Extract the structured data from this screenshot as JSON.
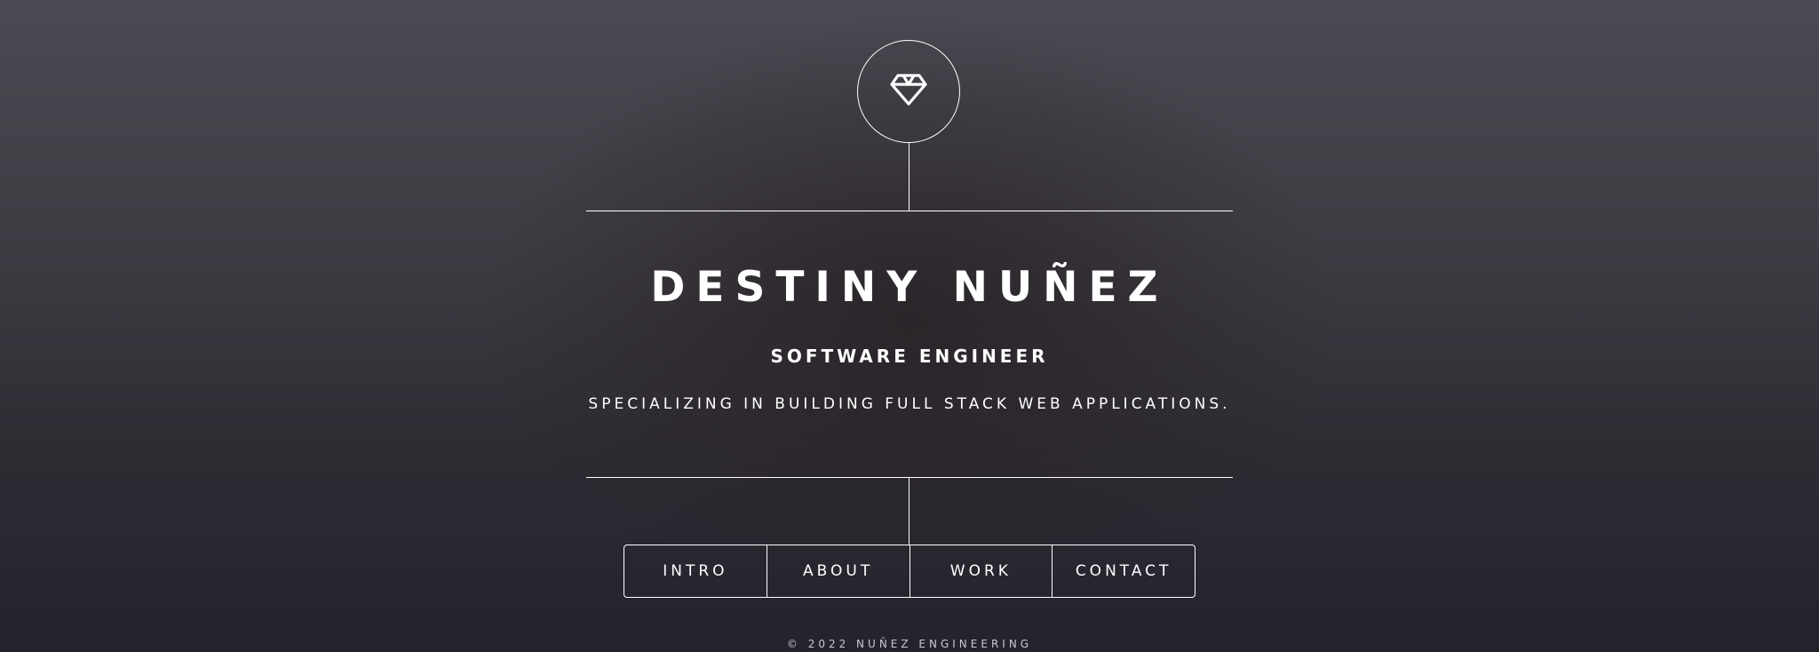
{
  "header": {
    "logo_icon": "diamond-icon",
    "name": "DESTINY NUÑEZ",
    "role": "SOFTWARE ENGINEER",
    "tagline": "SPECIALIZING IN BUILDING FULL STACK WEB APPLICATIONS."
  },
  "nav": {
    "items": [
      {
        "label": "INTRO"
      },
      {
        "label": "ABOUT"
      },
      {
        "label": "WORK"
      },
      {
        "label": "CONTACT"
      }
    ]
  },
  "footer": {
    "copyright": "© 2022 NUÑEZ ENGINEERING"
  },
  "colors": {
    "foreground": "#ffffff",
    "background_top": "#4a4a52",
    "background_bottom": "#23232d"
  }
}
